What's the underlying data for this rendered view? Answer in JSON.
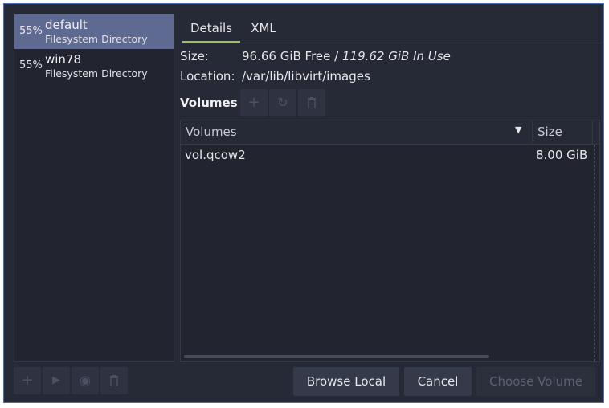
{
  "pools": [
    {
      "percent": "55%",
      "name": "default",
      "type": "Filesystem Directory",
      "selected": true
    },
    {
      "percent": "55%",
      "name": "win78",
      "type": "Filesystem Directory",
      "selected": false
    }
  ],
  "tabs": [
    {
      "label": "Details",
      "active": true
    },
    {
      "label": "XML",
      "active": false
    }
  ],
  "details": {
    "size_label": "Size:",
    "size_free": "96.66 GiB Free / ",
    "size_in_use": "119.62 GiB In Use",
    "location_label": "Location:",
    "location_value": "/var/lib/libvirt/images"
  },
  "volumes": {
    "heading": "Volumes",
    "columns": {
      "name": "Volumes",
      "size": "Size"
    },
    "rows": [
      {
        "name": "vol.qcow2",
        "size": "8.00 GiB"
      }
    ]
  },
  "buttons": {
    "browse_local": "Browse Local",
    "cancel": "Cancel",
    "choose_volume": "Choose Volume"
  },
  "icons": {
    "add": "+",
    "start": "▶",
    "stop": "◉",
    "delete": "🗑",
    "refresh": "↻",
    "sort_down": "▼"
  },
  "colors": {
    "background": "#262a36",
    "selection": "#5f6a92",
    "tab_accent": "#9cc35a"
  }
}
